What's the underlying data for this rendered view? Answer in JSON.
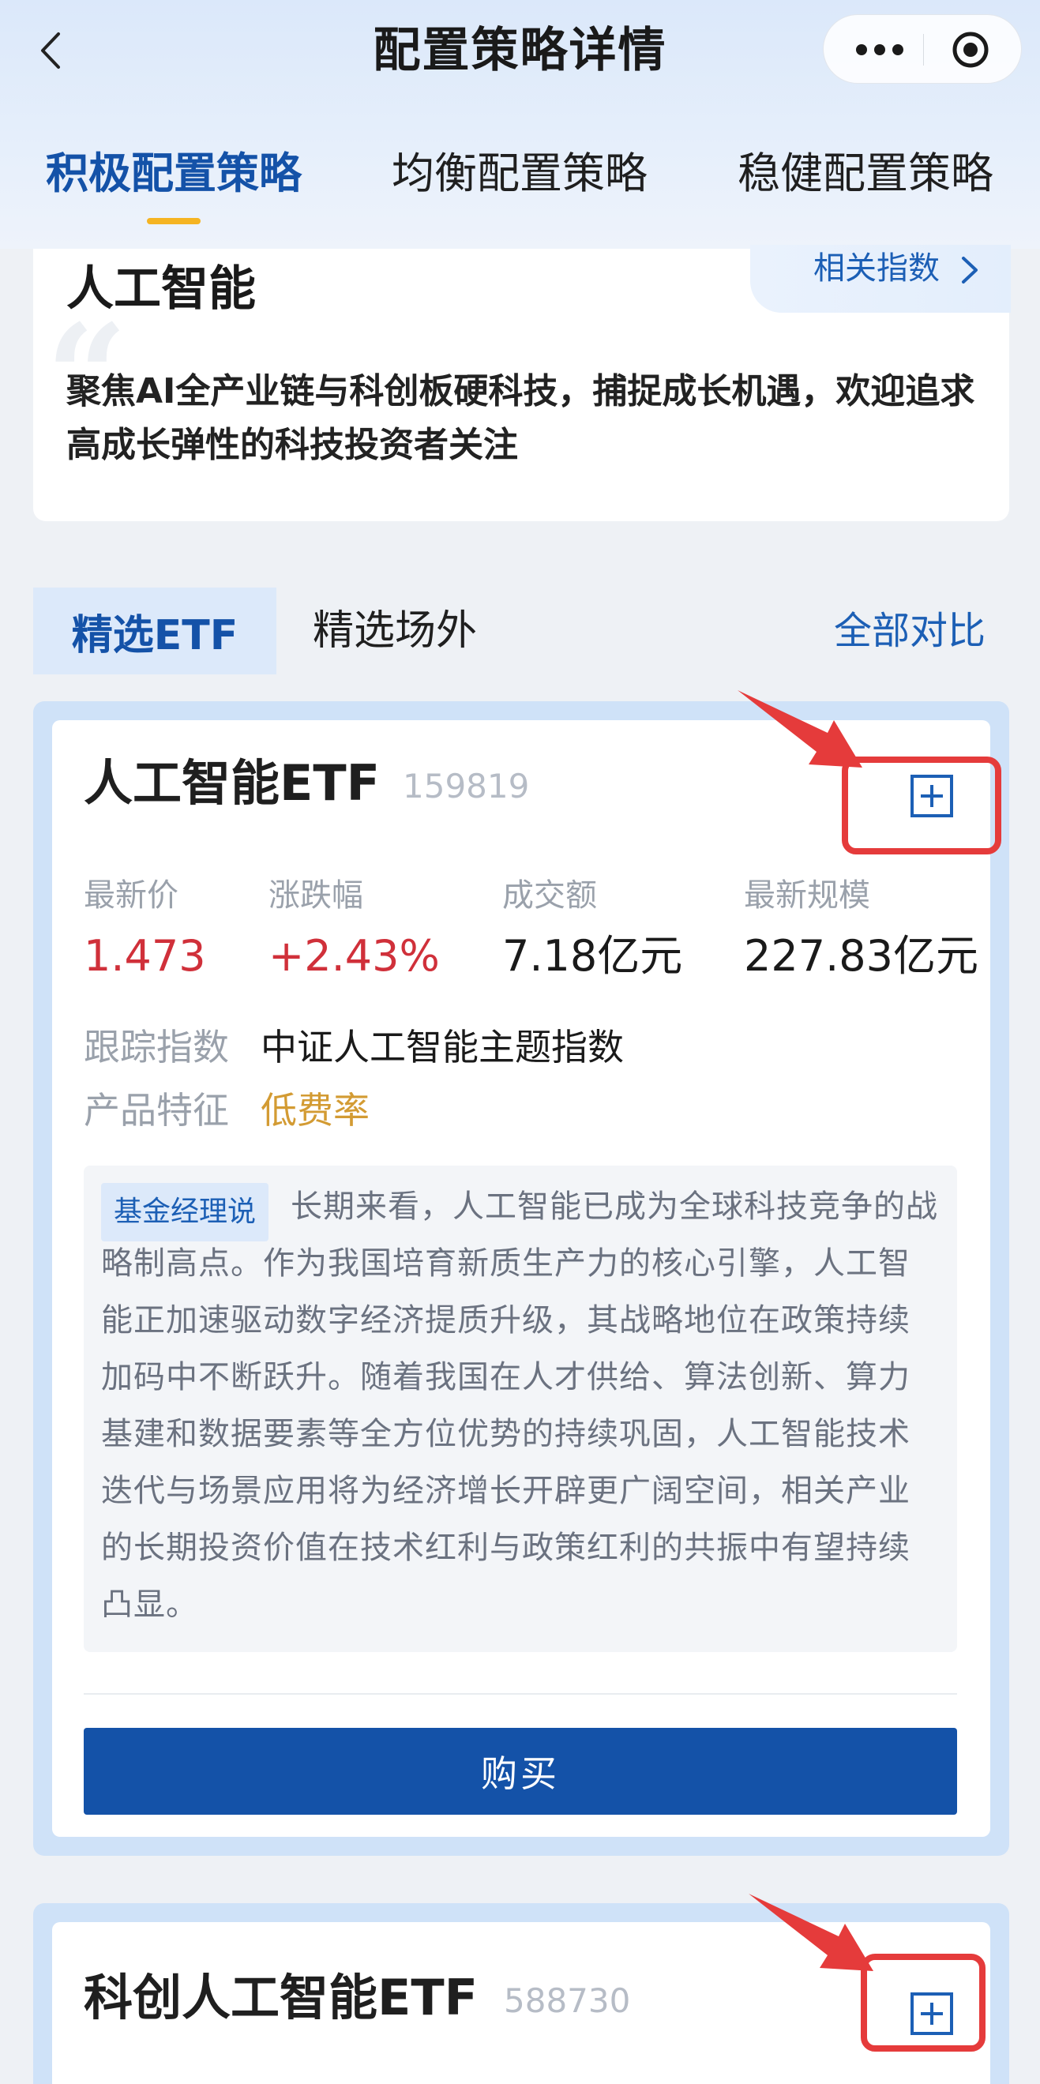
{
  "header": {
    "title": "配置策略详情",
    "tabs": [
      {
        "label": "积极配置策略",
        "active": true
      },
      {
        "label": "均衡配置策略",
        "active": false
      },
      {
        "label": "稳健配置策略",
        "active": false
      }
    ]
  },
  "intro": {
    "title": "人工智能",
    "related_link": "相关指数",
    "description": "聚焦AI全产业链与科创板硬科技，捕捉成长机遇，欢迎追求高成长弹性的科技投资者关注"
  },
  "section_tabs": {
    "active": "精选ETF",
    "inactive": "精选场外",
    "compare_all": "全部对比"
  },
  "funds": [
    {
      "name": "人工智能ETF",
      "code": "159819",
      "metrics": [
        {
          "label": "最新价",
          "value": "1.473"
        },
        {
          "label": "涨跌幅",
          "value": "+2.43%"
        },
        {
          "label": "成交额",
          "value": "7.18亿元"
        },
        {
          "label": "最新规模",
          "value": "227.83亿元"
        }
      ],
      "tracking_label": "跟踪指数",
      "tracking_value": "中证人工智能主题指数",
      "feature_label": "产品特征",
      "feature_value": "低费率",
      "manager_tag": "基金经理说",
      "manager_text": "长期来看，人工智能已成为全球科技竞争的战略制高点。作为我国培育新质生产力的核心引擎，人工智能正加速驱动数字经济提质升级，其战略地位在政策持续加码中不断跃升。随着我国在人才供给、算法创新、算力基建和数据要素等全方位优势的持续巩固，人工智能技术迭代与场景应用将为经济增长开辟更广阔空间，相关产业的长期投资价值在技术红利与政策红利的共振中有望持续凸显。",
      "buy_label": "购买"
    },
    {
      "name": "科创人工智能ETF",
      "code": "588730"
    }
  ],
  "colors": {
    "brand_blue": "#1452a8",
    "accent_yellow": "#f5b422",
    "rise_red": "#d0303a",
    "feature_gold": "#d39b33",
    "annotation_red": "#e53b3b"
  }
}
